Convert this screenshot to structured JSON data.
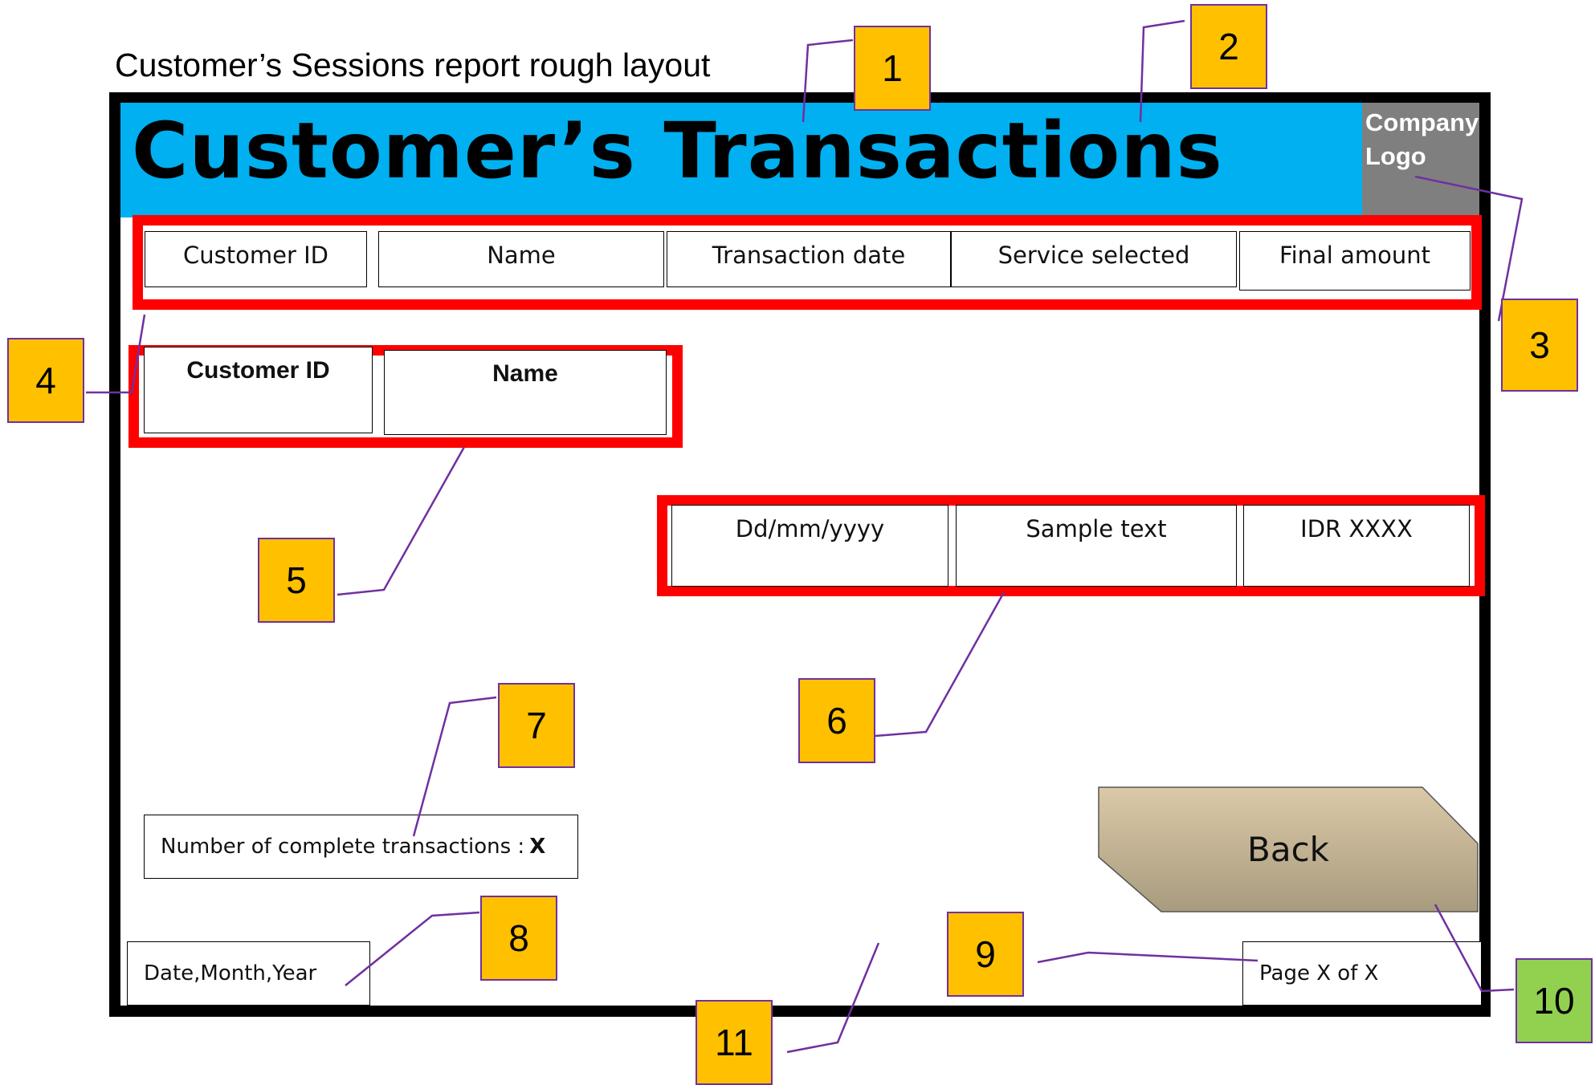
{
  "caption": "Customer’s Sessions report rough layout",
  "header": {
    "title": "Customer’s Transactions",
    "logo_line1": "Company",
    "logo_line2": "Logo"
  },
  "column_headers": [
    "Customer ID",
    "Name",
    "Transaction date",
    "Service selected",
    "Final amount"
  ],
  "customer_fields": [
    "Customer ID",
    "Name"
  ],
  "transaction_row": [
    "Dd/mm/yyyy",
    "Sample text",
    "IDR XXXX"
  ],
  "summary": {
    "label": "Number of complete transactions : ",
    "value": "X"
  },
  "footer": {
    "date": "Date,Month,Year",
    "page": "Page X of X",
    "back_label": "Back"
  },
  "callouts": [
    "1",
    "2",
    "3",
    "4",
    "5",
    "6",
    "7",
    "8",
    "9",
    "10",
    "11"
  ],
  "colors": {
    "banner": "#00b0f0",
    "logo": "#7f7f7f",
    "highlight": "#ff0000",
    "callout": "#ffc000",
    "callout_alt": "#92d050",
    "leader": "#7030a0"
  }
}
